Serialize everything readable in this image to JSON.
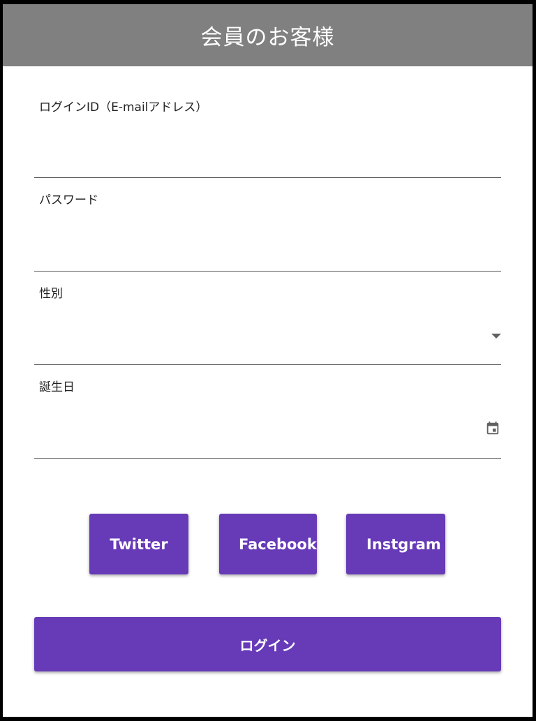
{
  "header": {
    "title": "会員のお客様"
  },
  "form": {
    "login_id_label": "ログインID（E-mailアドレス）",
    "login_id_value": "",
    "password_label": "パスワード",
    "password_value": "",
    "gender_label": "性別",
    "gender_value": "",
    "birthday_label": "誕生日",
    "birthday_value": ""
  },
  "social": {
    "twitter_label": "Twitter",
    "facebook_label": "Facebook",
    "instagram_label": "Instgram"
  },
  "login_button_label": "ログイン",
  "colors": {
    "header_bg": "#808080",
    "accent": "#673ab7",
    "underline": "#555555"
  },
  "icons": {
    "gender_select": "chevron-down-icon",
    "birthday_picker": "calendar-icon"
  }
}
